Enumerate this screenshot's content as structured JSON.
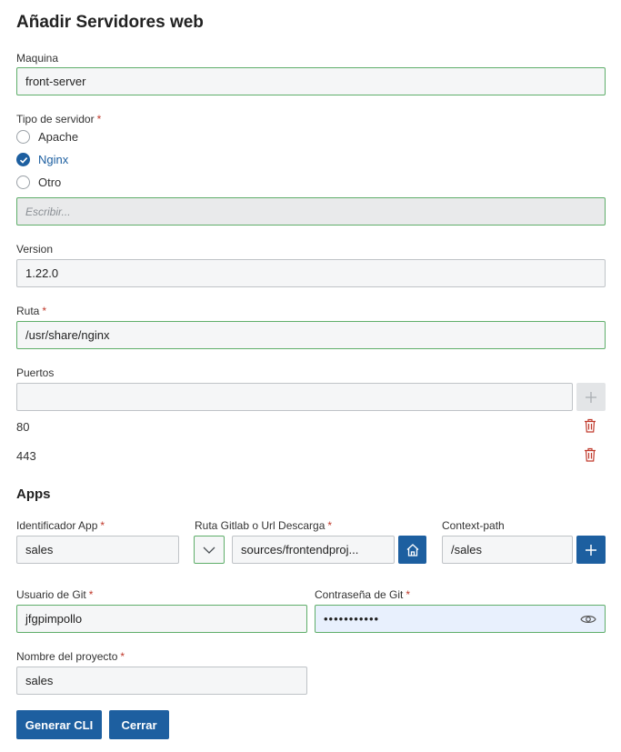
{
  "page": {
    "title": "Añadir Servidores web"
  },
  "maquina": {
    "label": "Maquina",
    "value": "front-server"
  },
  "tipo_servidor": {
    "label": "Tipo de servidor",
    "required_mark": "*",
    "options": [
      {
        "label": "Apache",
        "checked": false
      },
      {
        "label": "Nginx",
        "checked": true
      },
      {
        "label": "Otro",
        "checked": false
      }
    ],
    "other_placeholder": "Escribir..."
  },
  "version": {
    "label": "Version",
    "value": "1.22.0"
  },
  "ruta": {
    "label": "Ruta",
    "required_mark": "*",
    "value": "/usr/share/nginx"
  },
  "puertos": {
    "label": "Puertos",
    "input_value": "",
    "items": [
      "80",
      "443"
    ]
  },
  "apps": {
    "heading": "Apps",
    "identificador": {
      "label": "Identificador App",
      "required_mark": "*",
      "value": "sales"
    },
    "ruta_gitlab": {
      "label": "Ruta Gitlab o Url Descarga",
      "required_mark": "*",
      "value": "sources/frontendproj..."
    },
    "context_path": {
      "label": "Context-path",
      "value": "/sales"
    },
    "usuario_git": {
      "label": "Usuario de Git",
      "required_mark": "*",
      "value": "jfgpimpollo"
    },
    "contrasena_git": {
      "label": "Contraseña de Git",
      "required_mark": "*",
      "value": "•••••••••••"
    },
    "nombre_proyecto": {
      "label": "Nombre del proyecto",
      "required_mark": "*",
      "value": "sales"
    }
  },
  "buttons": {
    "generar": "Generar CLI",
    "cerrar": "Cerrar"
  },
  "icons": {
    "add_port": "plus-icon",
    "delete_port": "trash-icon",
    "dropdown": "chevron-down-icon",
    "home": "home-icon",
    "add_app": "plus-icon",
    "show_password": "eye-icon",
    "radio_checked": "check-icon"
  },
  "colors": {
    "primary": "#1d5fa0",
    "valid_border": "#5fae6a",
    "required": "#c0392b",
    "danger": "#c0392b"
  }
}
